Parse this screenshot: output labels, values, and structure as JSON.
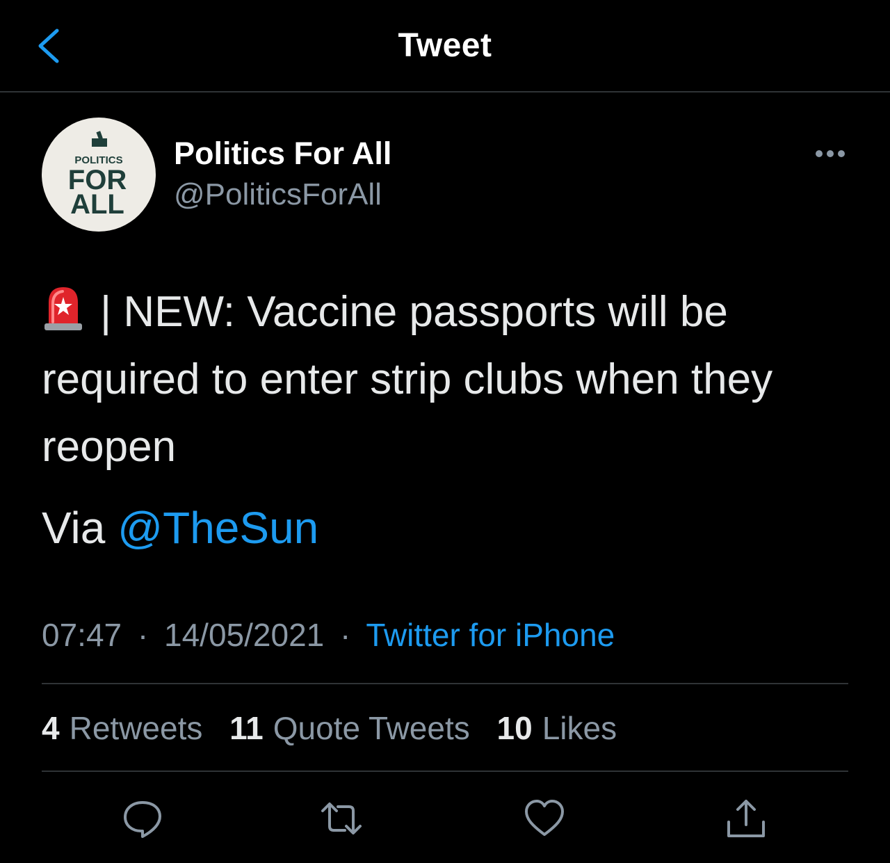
{
  "header": {
    "title": "Tweet"
  },
  "author": {
    "name": "Politics For All",
    "handle": "@PoliticsForAll",
    "avatar_text": [
      "POLITICS",
      "FOR",
      "ALL"
    ]
  },
  "tweet": {
    "line1": "| NEW: Vaccine passports will be",
    "line2": "required to enter strip clubs when they",
    "line3": "reopen",
    "via_prefix": "Via ",
    "mention": "@TheSun",
    "emoji": "police-car-light"
  },
  "meta": {
    "time": "07:47",
    "date": "14/05/2021",
    "separator": "·",
    "source": "Twitter for iPhone"
  },
  "stats": {
    "retweets_count": "4",
    "retweets_label": "Retweets",
    "quotes_count": "11",
    "quotes_label": "Quote Tweets",
    "likes_count": "10",
    "likes_label": "Likes"
  },
  "actions": [
    "reply-icon",
    "retweet-icon",
    "like-icon",
    "share-icon"
  ],
  "colors": {
    "background": "#000000",
    "accent": "#1d9bf0",
    "secondary_text": "#8b98a5",
    "divider": "#2f3336",
    "avatar_bg": "#eeece6",
    "avatar_text": "#1f3f3a"
  }
}
